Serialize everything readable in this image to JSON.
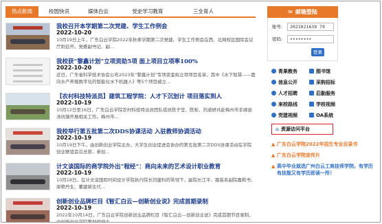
{
  "tabs": [
    {
      "label": "热点新闻",
      "active": true
    },
    {
      "label": "校园快讯",
      "active": false
    },
    {
      "label": "媒体白云",
      "active": false
    },
    {
      "label": "党史学习教育",
      "active": false
    },
    {
      "label": "三全育人",
      "active": false
    }
  ],
  "news": [
    {
      "title": "我校召开本学期第二次党建、学生工作例会",
      "date": "2022-10-20",
      "summary": "10月19日上午，广东白云学院2022年秋季学期第二次党建、学生工作例会在西、北网校区国际会议厅则召开。党委副书记、副...",
      "thumb": "meeting"
    },
    {
      "title": "我校获“黎鑫计划”立项资助5项 面上项目立项率100%",
      "date": "2022-10-20",
      "summary": "近日，广东省科学技术协会公布2023年“黎鑫计划”专项资金拟立项项目名单，其中《水下智慧——面向水产养殖数字化的智能化水下机器人》等5个项目被立...",
      "thumb": "table"
    },
    {
      "title": "【农村科技特派员】建筑工程学院：人才下沉划计 项目落实到人",
      "date": "2022-10-19",
      "summary": "10月12日至16日，广东白云学院农村科技特派员团队成员陈子莹、陈梨、刘淑妍共赴梅州市丰顺县汤坑镇开展相关工作。梅州市...",
      "thumb": "field"
    },
    {
      "title": "我校举行第五批第二次DDS协课活动 入驻教师协调活动",
      "date": "2022-10-19",
      "summary": "10月19日下午，由创新创业学院主办，大学生创业促进会协办的第五批第二次DDS协课活动在学院创业联谊会议总部，参加...",
      "thumb": "event"
    },
    {
      "title": "计文谈国际的商学院外出“程经”：商向未来的艺术设计职业教育",
      "date": "2022-10-19",
      "summary": "10月18日，在计文谈国际时间设计学院执行院长刘建科的带领下，副院长江平、服装系副院嘉和书、梁艳丹生、董建新生代...",
      "thumb": "group"
    },
    {
      "title": "创新创业品牌栏目《智汇白云—创新创业说》完成首期录制",
      "date": "2022-10-19",
      "summary": "2022年10月14日，广东白云学院创新创业品牌栏目《智汇白云—创新创业说》完成首期节目录制，由创新创业学院策划组织主...",
      "thumb": "studio"
    }
  ],
  "login": {
    "header": "邮箱登陆",
    "account_label": "账号:",
    "account_value": "2021021639 79",
    "password_label": "密码:",
    "password_value": "••••••••",
    "button": "登录"
  },
  "links": [
    {
      "label": "青果教务",
      "icon": "book-icon"
    },
    {
      "label": "图书馆",
      "icon": "library-icon"
    },
    {
      "label": "信息公开",
      "icon": "info-icon"
    },
    {
      "label": "采购招标",
      "icon": "bid-icon"
    },
    {
      "label": "人才招聘",
      "icon": "recruit-icon"
    },
    {
      "label": "后勤服务",
      "icon": "service-icon"
    },
    {
      "label": "来校路线",
      "icon": "route-icon"
    },
    {
      "label": "学校视频",
      "icon": "video-icon"
    },
    {
      "label": "党建视频",
      "icon": "party-video-icon"
    },
    {
      "label": "OA系统",
      "icon": "oa-icon"
    }
  ],
  "resource_link": "资源访问平台",
  "promos": [
    {
      "text": "广东白云学院2022年招生专业目录书",
      "color": "#e8782a"
    },
    {
      "text": "广东白云学院宣传片",
      "color": "#e8782a"
    },
    {
      "text_line1": "高中毕业就选广州白云工商技师学院，有学历",
      "text_line2": "有技能又有学历即读一所！",
      "color": "#2f6fc6"
    }
  ],
  "colors": {
    "accent": "#e8782a",
    "link": "#1a3a8a",
    "button": "#2f6fc6",
    "highlight": "#d9202a"
  }
}
